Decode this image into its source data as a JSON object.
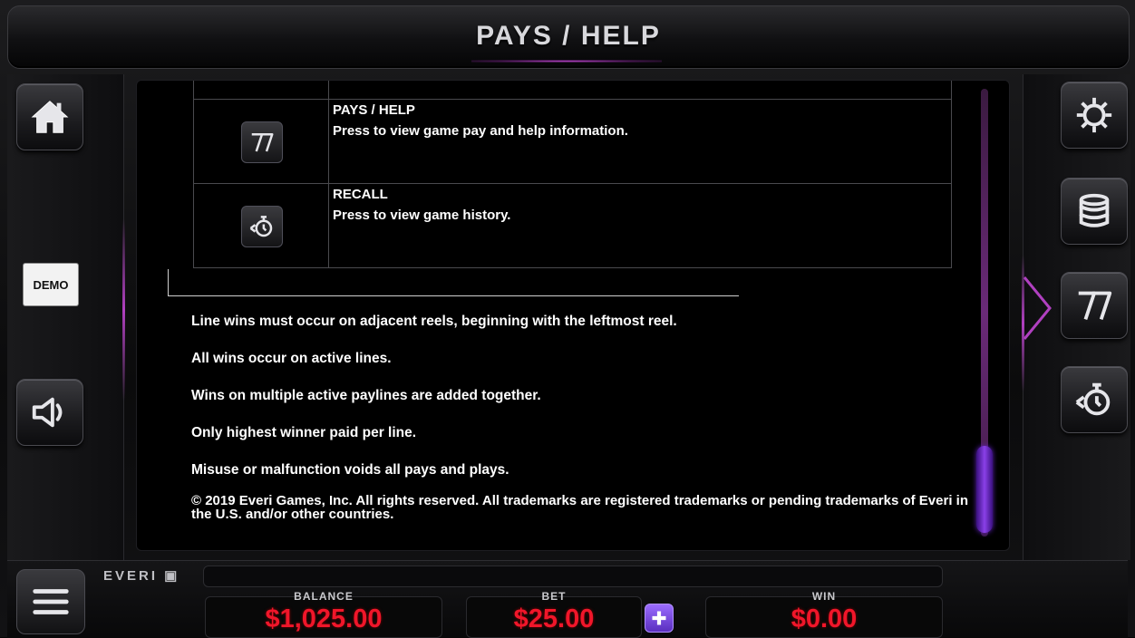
{
  "header": {
    "title": "PAYS / HELP"
  },
  "left_sidebar": {
    "home_icon": "home-icon",
    "demo_label": "DEMO",
    "sound_icon": "speaker-icon"
  },
  "right_sidebar": {
    "settings_icon": "gear-icon",
    "denomination_icon": "coin-stack-icon",
    "pays_icon": "seven-icon",
    "recall_icon": "recall-icon"
  },
  "help_table": {
    "rows": [
      {
        "icon": "seven-icon",
        "title": "PAYS / HELP",
        "description": "Press to view game pay and help information."
      },
      {
        "icon": "recall-icon",
        "title": "RECALL",
        "description": "Press to view game history."
      }
    ]
  },
  "rules": [
    "Line wins must occur on adjacent reels, beginning with the leftmost reel.",
    "All wins occur on active lines.",
    "Wins on multiple active paylines are added together.",
    "Only highest winner paid per line.",
    "Misuse or malfunction voids all pays and plays."
  ],
  "copyright": "© 2019 Everi Games, Inc. All rights reserved. All trademarks are registered trademarks or pending trademarks of Everi in the U.S. and/or other countries.",
  "footer": {
    "logo_text": "EVERI",
    "balance_label": "BALANCE",
    "balance_value": "$1,025.00",
    "bet_label": "BET",
    "bet_value": "$25.00",
    "win_label": "WIN",
    "win_value": "$0.00",
    "menu_icon": "hamburger-menu-icon",
    "plus_icon": "plus-icon"
  },
  "colors": {
    "accent_purple": "#8a40e8",
    "meter_red": "#f0162a"
  }
}
